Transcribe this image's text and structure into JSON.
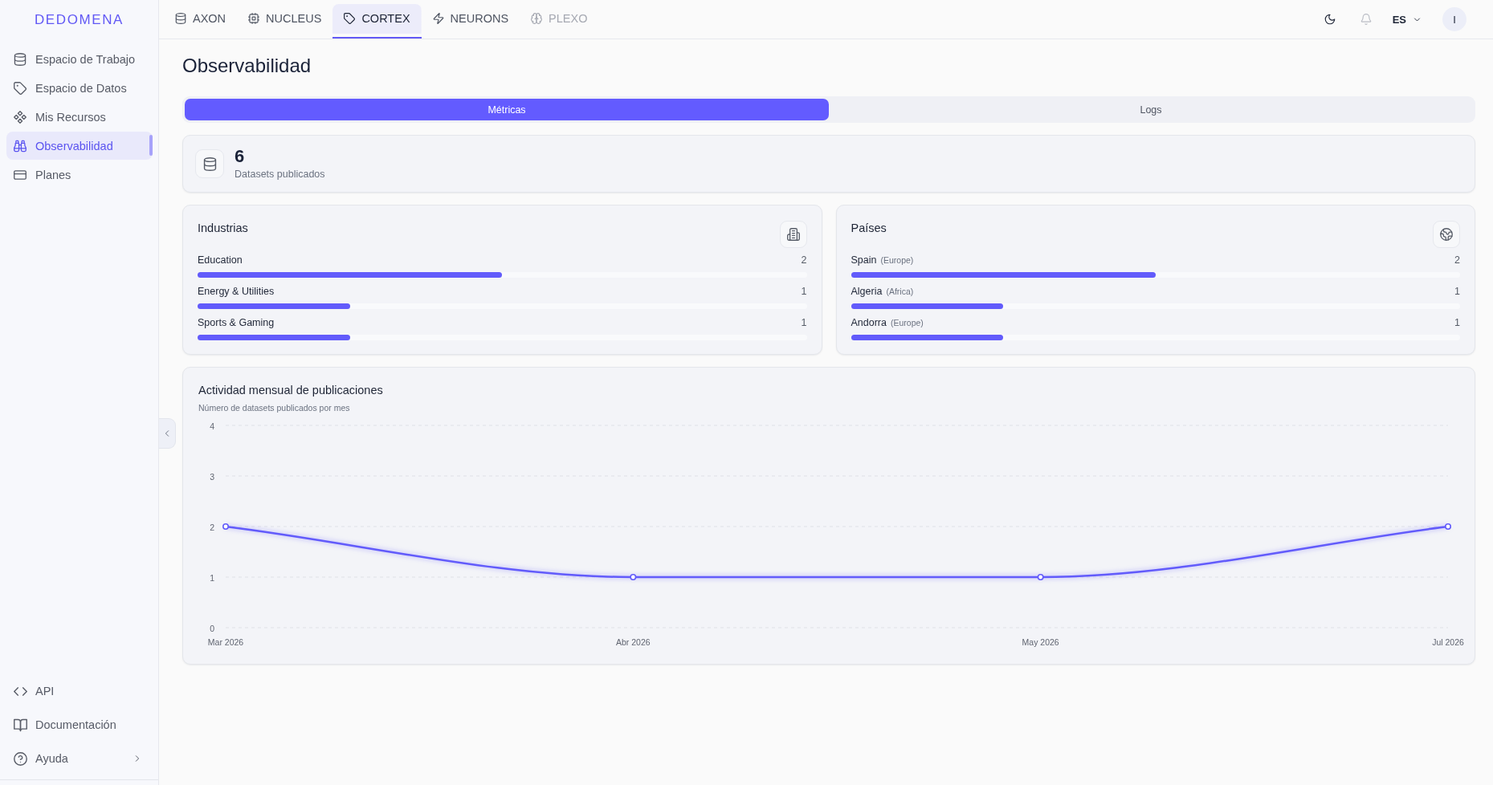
{
  "sidebar": {
    "logo": "DEDOMENA",
    "items": [
      {
        "label": "Espacio de Trabajo",
        "selected": false
      },
      {
        "label": "Espacio de Datos",
        "selected": false
      },
      {
        "label": "Mis Recursos",
        "selected": false
      },
      {
        "label": "Observabilidad",
        "selected": true
      },
      {
        "label": "Planes",
        "selected": false
      }
    ],
    "footer_items": [
      {
        "label": "API",
        "kind": "link"
      },
      {
        "label": "Documentación",
        "kind": "link"
      },
      {
        "label": "Ayuda",
        "kind": "submenu"
      }
    ]
  },
  "top_tabs": [
    {
      "label": "AXON",
      "selected": false,
      "disabled": false
    },
    {
      "label": "NUCLEUS",
      "selected": false,
      "disabled": false
    },
    {
      "label": "CORTEX",
      "selected": true,
      "disabled": false
    },
    {
      "label": "NEURONS",
      "selected": false,
      "disabled": false
    },
    {
      "label": "PLEXO",
      "selected": false,
      "disabled": true
    }
  ],
  "header": {
    "notifications": {
      "disabled": true
    },
    "language": "ES",
    "user_initial": "I"
  },
  "page_title": "Observabilidad",
  "view_tabs": [
    {
      "label": "Métricas",
      "selected": true
    },
    {
      "label": "Logs",
      "selected": false
    }
  ],
  "summary": {
    "value": "6",
    "label": "Datasets publicados"
  },
  "industries": {
    "title": "Industrias",
    "rows": [
      {
        "name": "Education",
        "count": "2",
        "level": 0.5
      },
      {
        "name": "Energy & Utilities",
        "count": "1",
        "level": 0.25
      },
      {
        "name": "Sports & Gaming",
        "count": "1",
        "level": 0.25
      }
    ]
  },
  "countries": {
    "title": "Países",
    "rows": [
      {
        "name": "Spain",
        "region": "(Europe)",
        "count": "2",
        "level": 0.5
      },
      {
        "name": "Algeria",
        "region": "(Africa)",
        "count": "1",
        "level": 0.25
      },
      {
        "name": "Andorra",
        "region": "(Europe)",
        "count": "1",
        "level": 0.25
      }
    ]
  },
  "activity": {
    "chart_data": [
      {
        "type": "line",
        "title": "Actividad mensual de publicaciones",
        "subtitle": "Número de datasets publicados por mes",
        "categories": [
          "Mar 2026",
          "Abr 2026",
          "May 2026",
          "Jul 2026"
        ],
        "values": [
          2,
          1,
          1,
          2
        ],
        "color": "#625bfb",
        "ylim": [
          0,
          4
        ],
        "yticks": [
          0,
          1,
          2,
          3,
          4
        ],
        "grid": true,
        "marker": "circle"
      }
    ]
  }
}
